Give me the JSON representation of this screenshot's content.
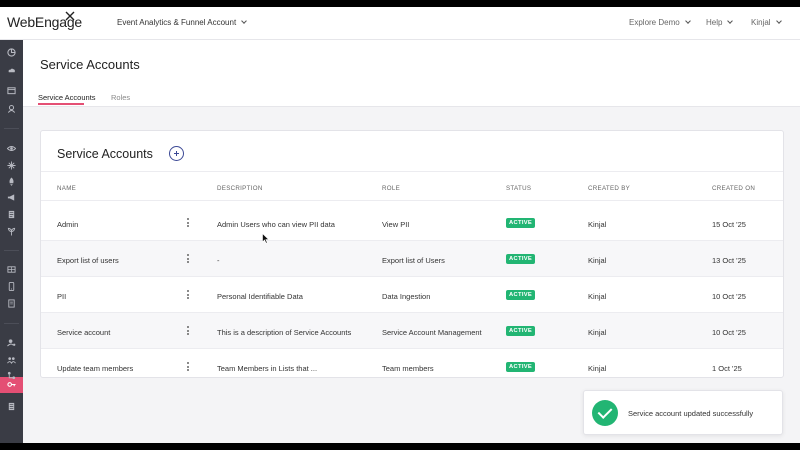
{
  "brand": {
    "logo_text": "WebEngage"
  },
  "topbar": {
    "account_label": "Event Analytics & Funnel Account",
    "explore_label": "Explore Demo",
    "help_label": "Help",
    "user_label": "Kinjal"
  },
  "page": {
    "title": "Service Accounts",
    "tabs": [
      {
        "label": "Service Accounts",
        "active": true
      },
      {
        "label": "Roles",
        "active": false
      }
    ]
  },
  "card": {
    "title": "Service Accounts",
    "columns": [
      "NAME",
      "DESCRIPTION",
      "ROLE",
      "STATUS",
      "CREATED BY",
      "CREATED ON"
    ],
    "rows": [
      {
        "name": "Admin",
        "description": "Admin Users who can view PII data",
        "role": "View PII",
        "status": "ACTIVE",
        "created_by": "Kinjal",
        "created_on": "15 Oct '25"
      },
      {
        "name": "Export list of users",
        "description": "-",
        "role": "Export list of Users",
        "status": "ACTIVE",
        "created_by": "Kinjal",
        "created_on": "13 Oct '25"
      },
      {
        "name": "PII",
        "description": "Personal Identifiable Data",
        "role": "Data Ingestion",
        "status": "ACTIVE",
        "created_by": "Kinjal",
        "created_on": "10 Oct '25"
      },
      {
        "name": "Service account",
        "description": "This is a description of Service Accounts",
        "role": "Service Account Management",
        "status": "ACTIVE",
        "created_by": "Kinjal",
        "created_on": "10 Oct '25"
      },
      {
        "name": "Update team members",
        "description": "Team Members in Lists that ...",
        "role": "Team members",
        "status": "ACTIVE",
        "created_by": "Kinjal",
        "created_on": "1 Oct '25"
      }
    ]
  },
  "toast": {
    "message": "Service account updated successfully"
  },
  "colors": {
    "accent": "#e44f74",
    "sidebar": "#3a3c45",
    "success": "#22b573",
    "link": "#3d4a96"
  },
  "sidebar_icons": [
    "dashboard-icon",
    "cloud-icon",
    "folder-icon",
    "users-icon",
    "eye-icon",
    "sparkle-icon",
    "rocket-icon",
    "megaphone-icon",
    "document-icon",
    "sprout-icon",
    "grid-icon",
    "mobile-icon",
    "list-icon",
    "user-settings-icon",
    "team-icon",
    "flow-icon",
    "key-icon",
    "report-icon"
  ]
}
